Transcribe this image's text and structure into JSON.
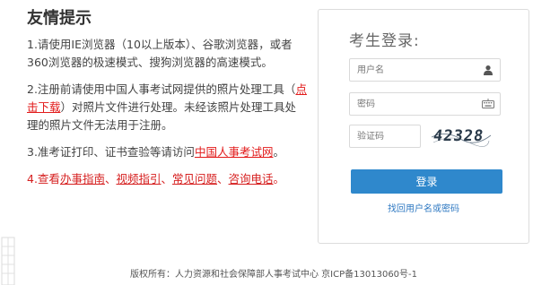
{
  "notice": {
    "title": "友情提示",
    "tip1": "1.请使用IE浏览器（10以上版本）、谷歌浏览器，或者360浏览器的极速模式、搜狗浏览器的高速模式。",
    "tip2": {
      "before": "2.注册前请使用中国人事考试网提供的照片处理工具（",
      "link": "点击下载",
      "after": "）对照片文件进行处理。未经该照片处理工具处理的照片文件无法用于注册。"
    },
    "tip3": {
      "before": "3.准考证打印、证书查验等请访问",
      "link": "中国人事考试网",
      "after": "。"
    },
    "tip4": {
      "prefix": "4.查看",
      "links": [
        "办事指南",
        "视频指引",
        "常见问题",
        "咨询电话"
      ],
      "separator": "、",
      "suffix": "。"
    }
  },
  "login": {
    "title": "考生登录:",
    "username_placeholder": "用户名",
    "password_placeholder": "密码",
    "captcha_placeholder": "验证码",
    "captcha_text": "42328",
    "submit_label": "登录",
    "recover_label": "找回用户名或密码"
  },
  "footer": {
    "text": "版权所有：人力资源和社会保障部人事考试中心 京ICP备13013060号-1"
  },
  "colors": {
    "accent_blue": "#2f88cc",
    "link_red": "#e21a1a",
    "link_blue": "#2f79c2"
  },
  "icons": {
    "username": "user-icon",
    "password": "keyboard-icon"
  }
}
